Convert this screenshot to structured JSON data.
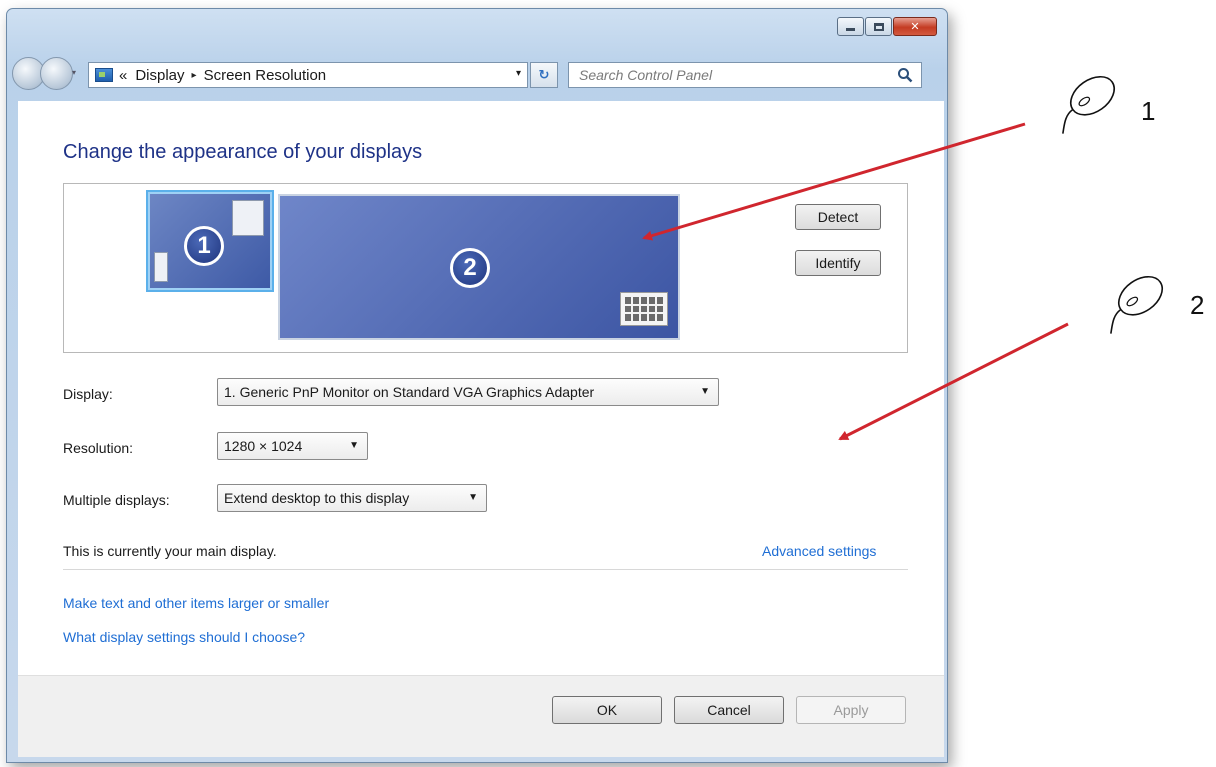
{
  "window": {
    "controls": {
      "minimize_icon": "minimize-icon",
      "maximize_icon": "maximize-icon",
      "close_icon": "close-icon",
      "close_glyph": "✕"
    }
  },
  "address_bar": {
    "overflow_glyph": "«",
    "crumbs": [
      "Display",
      "Screen Resolution"
    ],
    "separator": "▸",
    "dropdown_glyph": "▾",
    "refresh_glyph": "↻"
  },
  "search": {
    "placeholder": "Search Control Panel"
  },
  "page": {
    "title": "Change the appearance of your displays",
    "monitors": [
      {
        "number": "1",
        "selected": true
      },
      {
        "number": "2",
        "selected": false
      }
    ],
    "buttons": {
      "detect": "Detect",
      "identify": "Identify"
    },
    "fields": {
      "display": {
        "label": "Display:",
        "value": "1. Generic PnP Monitor on Standard VGA Graphics Adapter"
      },
      "resolution": {
        "label": "Resolution:",
        "value": "1280 × 1024"
      },
      "multiple": {
        "label": "Multiple displays:",
        "value": "Extend desktop to this display"
      }
    },
    "main_display_text": "This is currently your main display.",
    "advanced_link": "Advanced settings",
    "links": [
      "Make text and other items larger or smaller",
      "What display settings should I choose?"
    ]
  },
  "footer": {
    "ok": "OK",
    "cancel": "Cancel",
    "apply": "Apply",
    "apply_enabled": false
  },
  "callouts": [
    {
      "number": "1",
      "icon": "mouse-icon",
      "arrow_color": "#d0262e"
    },
    {
      "number": "2",
      "icon": "mouse-icon",
      "arrow_color": "#d0262e"
    }
  ]
}
